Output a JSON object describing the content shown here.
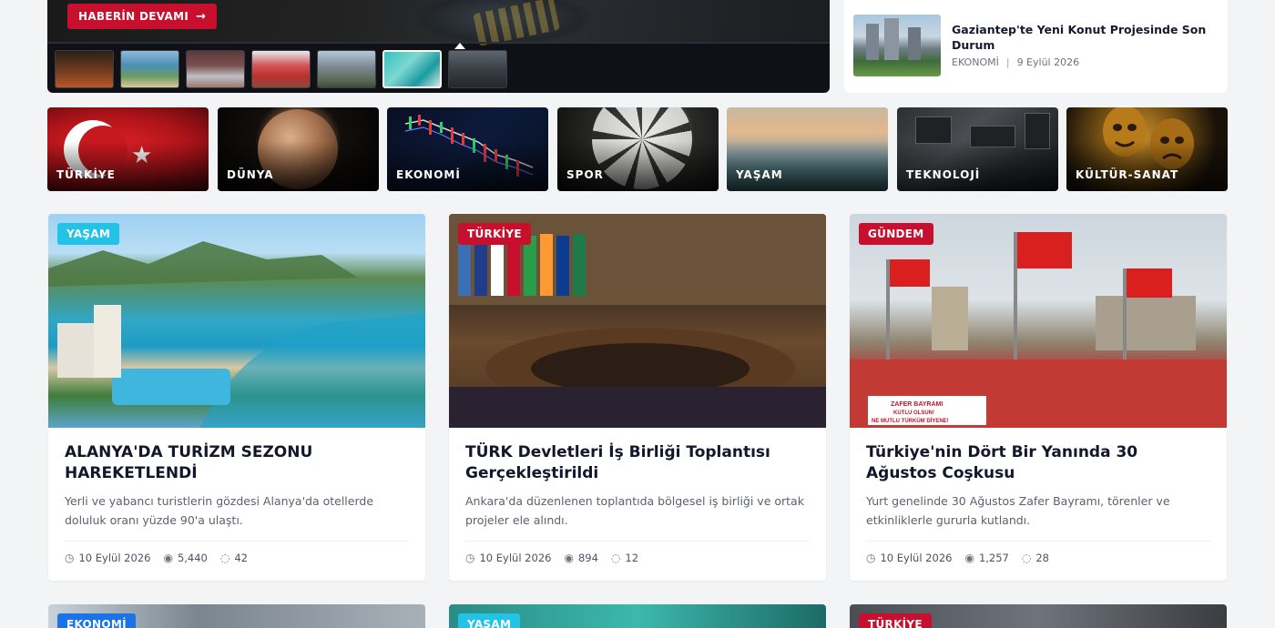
{
  "slider": {
    "read_more_label": "HABERİN DEVAMI",
    "read_more_icon": "arrow-right-icon",
    "active_thumb_index": 5,
    "thumb_count": 7
  },
  "side_news": {
    "title": "Gaziantep'te Yeni Konut Projesinde Son Durum",
    "category": "EKONOMİ",
    "separator": "|",
    "date": "9 Eylül 2026"
  },
  "categories": [
    {
      "label": "TÜRKİYE"
    },
    {
      "label": "DÜNYA"
    },
    {
      "label": "EKONOMİ"
    },
    {
      "label": "SPOR"
    },
    {
      "label": "YAŞAM"
    },
    {
      "label": "TEKNOLOJİ"
    },
    {
      "label": "KÜLTÜR-SANAT"
    }
  ],
  "articles": [
    {
      "badge": "YAŞAM",
      "badge_color": "#22c3e6",
      "title": "ALANYA'DA TURİZM SEZONU HAREKETLENDİ",
      "excerpt": "Yerli ve yabancı turistlerin gözdesi Alanya'da otellerde doluluk oranı yüzde 90'a ulaştı.",
      "date": "10 Eylül 2026",
      "views": "5,440",
      "comments": "42"
    },
    {
      "badge": "TÜRKİYE",
      "badge_color": "#c8102e",
      "title": "TÜRK Devletleri İş Birliği Toplantısı Gerçekleştirildi",
      "excerpt": "Ankara'da düzenlenen toplantıda bölgesel iş birliği ve ortak projeler ele alındı.",
      "date": "10 Eylül 2026",
      "views": "894",
      "comments": "12"
    },
    {
      "badge": "GÜNDEM",
      "badge_color": "#c8102e",
      "title": "Türkiye'nin Dört Bir Yanında 30 Ağustos Coşkusu",
      "excerpt": "Yurt genelinde 30 Ağustos Zafer Bayramı, törenler ve etkinliklerle gururla kutlandı.",
      "date": "10 Eylül 2026",
      "views": "1,257",
      "comments": "28"
    }
  ],
  "bottom_cards": [
    {
      "badge": "EKONOMİ",
      "badge_color": "#1a73e8"
    },
    {
      "badge": "YAŞAM",
      "badge_color": "#22c3e6"
    },
    {
      "badge": "TÜRKİYE",
      "badge_color": "#c8102e"
    }
  ],
  "image_texts": {
    "banner_line1": "ZAFER BAYRAMI",
    "banner_line2": "KUTLU OLSUN!",
    "banner_line3": "NE MUTLU TÜRKÜM DİYENE!"
  }
}
